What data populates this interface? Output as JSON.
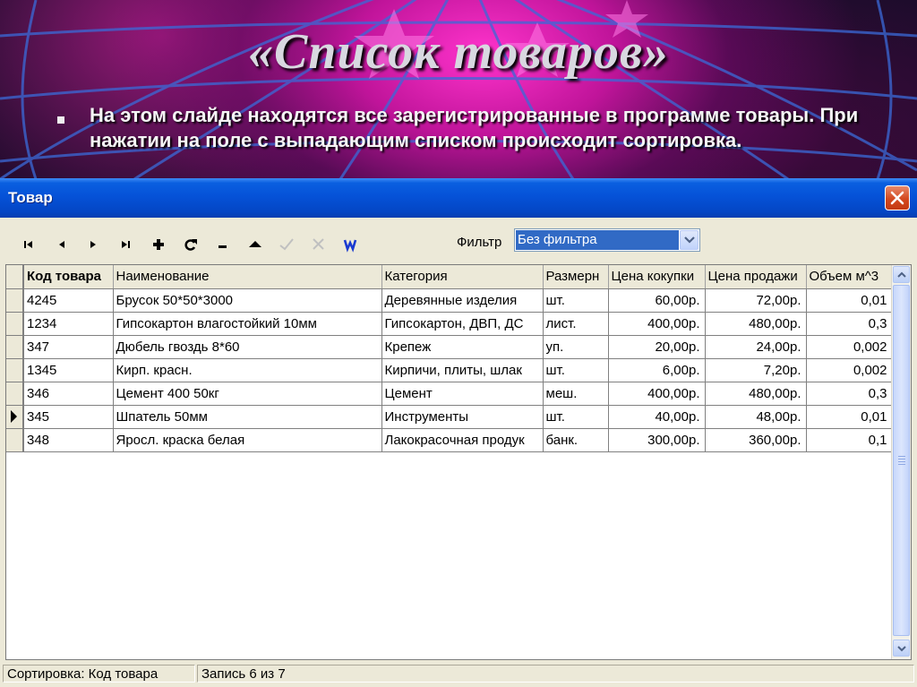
{
  "slide": {
    "title": "«Список товаров»",
    "bullet_text": "На этом слайде находятся все зарегистрированные в программе товары. При нажатии на поле с выпадающим списком происходит сортировка."
  },
  "window": {
    "title": "Товар"
  },
  "toolbar": {
    "buttons": [
      {
        "name": "first-record",
        "icon": "first-icon"
      },
      {
        "name": "prior-record",
        "icon": "prior-icon"
      },
      {
        "name": "next-record",
        "icon": "next-icon"
      },
      {
        "name": "last-record",
        "icon": "last-icon"
      },
      {
        "name": "insert-record",
        "icon": "plus-icon"
      },
      {
        "name": "refresh",
        "icon": "refresh-icon"
      },
      {
        "name": "delete-record",
        "icon": "minus-icon"
      },
      {
        "name": "edit-record",
        "icon": "up-icon"
      },
      {
        "name": "post-record",
        "icon": "check-icon",
        "disabled": true
      },
      {
        "name": "cancel-edit",
        "icon": "cancel-icon",
        "disabled": true
      },
      {
        "name": "report",
        "icon": "word-icon"
      }
    ],
    "filter_label": "Фильтр",
    "filter_value": "Без фильтра"
  },
  "grid": {
    "columns": [
      "Код товара",
      "Наименование",
      "Категория",
      "Размерн",
      "Цена кокупки",
      "Цена продажи",
      "Объем м^3"
    ],
    "rows": [
      [
        "4245",
        "Брусок 50*50*3000",
        "Деревянные изделия",
        "шт.",
        "60,00р.",
        "72,00р.",
        "0,01"
      ],
      [
        "1234",
        "Гипсокартон влагостойкий 10мм",
        "Гипсокартон, ДВП, ДС",
        "лист.",
        "400,00р.",
        "480,00р.",
        "0,3"
      ],
      [
        "347",
        "Дюбель гвоздь 8*60",
        "Крепеж",
        "уп.",
        "20,00р.",
        "24,00р.",
        "0,002"
      ],
      [
        "1345",
        "Кирп. красн.",
        "Кирпичи, плиты, шлак",
        "шт.",
        "6,00р.",
        "7,20р.",
        "0,002"
      ],
      [
        "346",
        "Цемент 400 50кг",
        "Цемент",
        "меш.",
        "400,00р.",
        "480,00р.",
        "0,3"
      ],
      [
        "345",
        "Шпатель 50мм",
        "Инструменты",
        "шт.",
        "40,00р.",
        "48,00р.",
        "0,01"
      ],
      [
        "348",
        "Яросл. краска белая",
        "Лакокрасочная продук",
        "банк.",
        "300,00р.",
        "360,00р.",
        "0,1"
      ]
    ],
    "current_row": 5
  },
  "status": {
    "sort": "Сортировка: Код товара",
    "record": "Запись 6 из 7"
  },
  "colors": {
    "titlebar": "#0552d8",
    "selection": "#316ac5",
    "window_bg": "#ece9d8"
  }
}
